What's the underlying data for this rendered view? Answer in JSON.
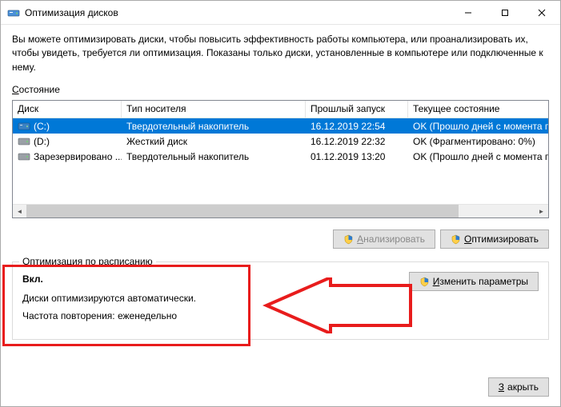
{
  "title": "Оптимизация дисков",
  "description": "Вы можете оптимизировать диски, чтобы повысить эффективность работы  компьютера, или проанализировать их, чтобы увидеть, требуется ли оптимизация. Показаны только диски, установленные в компьютере или подключенные к нему.",
  "state_label": "Состояние",
  "columns": {
    "c1": "Диск",
    "c2": "Тип носителя",
    "c3": "Прошлый запуск",
    "c4": "Текущее состояние"
  },
  "rows": [
    {
      "name": "(C:)",
      "type": "Твердотельный накопитель",
      "last": "16.12.2019 22:54",
      "status": "OK (Прошло дней с момента по",
      "icon": "ssd",
      "selected": true
    },
    {
      "name": "(D:)",
      "type": "Жесткий диск",
      "last": "16.12.2019 22:32",
      "status": "OK (Фрагментировано: 0%)",
      "icon": "hdd",
      "selected": false
    },
    {
      "name": "Зарезервировано ...",
      "type": "Твердотельный накопитель",
      "last": "01.12.2019 13:20",
      "status": "OK (Прошло дней с момента по",
      "icon": "hdd",
      "selected": false
    }
  ],
  "buttons": {
    "analyze": "Анализировать",
    "optimize": "Оптимизировать",
    "change": "Изменить параметры",
    "close": "Закрыть"
  },
  "schedule": {
    "title": "Оптимизация по расписанию",
    "state": "Вкл.",
    "line1": "Диски оптимизируются автоматически.",
    "line2": "Частота повторения: еженедельно"
  }
}
